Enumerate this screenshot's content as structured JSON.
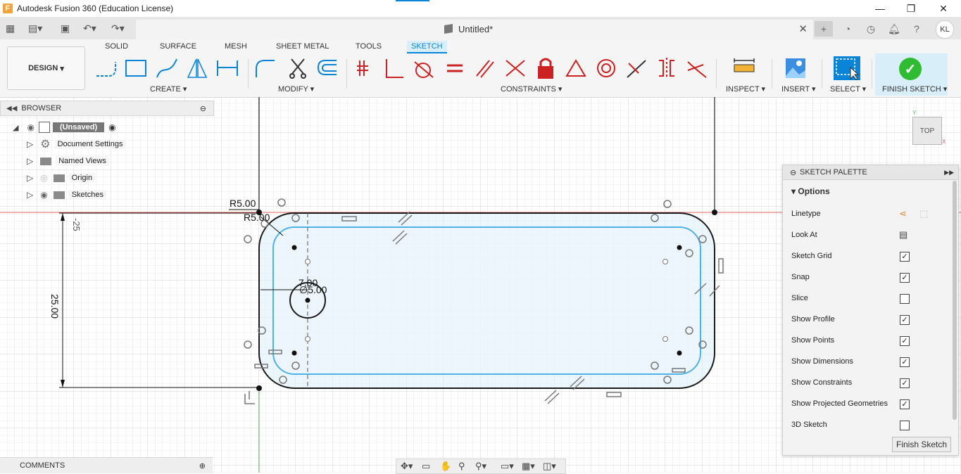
{
  "window": {
    "title": "Autodesk Fusion 360 (Education License)",
    "minimize": "—",
    "maximize": "❐",
    "close": "✕"
  },
  "document": {
    "title": "Untitled*"
  },
  "user": {
    "initials": "KL"
  },
  "toolbar": {
    "workspace": "DESIGN",
    "tabs": [
      "SOLID",
      "SURFACE",
      "MESH",
      "SHEET METAL",
      "TOOLS",
      "SKETCH"
    ],
    "active_tab": "SKETCH",
    "groups": {
      "create": "CREATE",
      "modify": "MODIFY",
      "constraints": "CONSTRAINTS",
      "inspect": "INSPECT",
      "insert": "INSERT",
      "select": "SELECT",
      "finish": "FINISH SKETCH"
    }
  },
  "browser": {
    "title": "BROWSER",
    "root": "(Unsaved)",
    "items": [
      "Document Settings",
      "Named Views",
      "Origin",
      "Sketches"
    ]
  },
  "comments": {
    "title": "COMMENTS"
  },
  "viewcube": {
    "label": "TOP"
  },
  "dimensions": {
    "r1": "R5.00",
    "r2": "R5.00",
    "height": "25.00",
    "neg": "-25",
    "d1": "7.00",
    "d2": "∅5.00"
  },
  "palette": {
    "title": "SKETCH PALETTE",
    "section": "Options",
    "rows": [
      {
        "label": "Linetype",
        "kind": "icons"
      },
      {
        "label": "Look At",
        "kind": "icon"
      },
      {
        "label": "Sketch Grid",
        "kind": "check",
        "checked": true
      },
      {
        "label": "Snap",
        "kind": "check",
        "checked": true
      },
      {
        "label": "Slice",
        "kind": "check",
        "checked": false
      },
      {
        "label": "Show Profile",
        "kind": "check",
        "checked": true
      },
      {
        "label": "Show Points",
        "kind": "check",
        "checked": true
      },
      {
        "label": "Show Dimensions",
        "kind": "check",
        "checked": true
      },
      {
        "label": "Show Constraints",
        "kind": "check",
        "checked": true
      },
      {
        "label": "Show Projected Geometries",
        "kind": "check",
        "checked": true
      },
      {
        "label": "3D Sketch",
        "kind": "check",
        "checked": false
      }
    ],
    "finish_button": "Finish Sketch"
  },
  "colors": {
    "accent": "#0a84d6",
    "profile_fill": "#dceefb",
    "offset_line": "#4db3e6",
    "finish_green": "#2fbb32"
  }
}
